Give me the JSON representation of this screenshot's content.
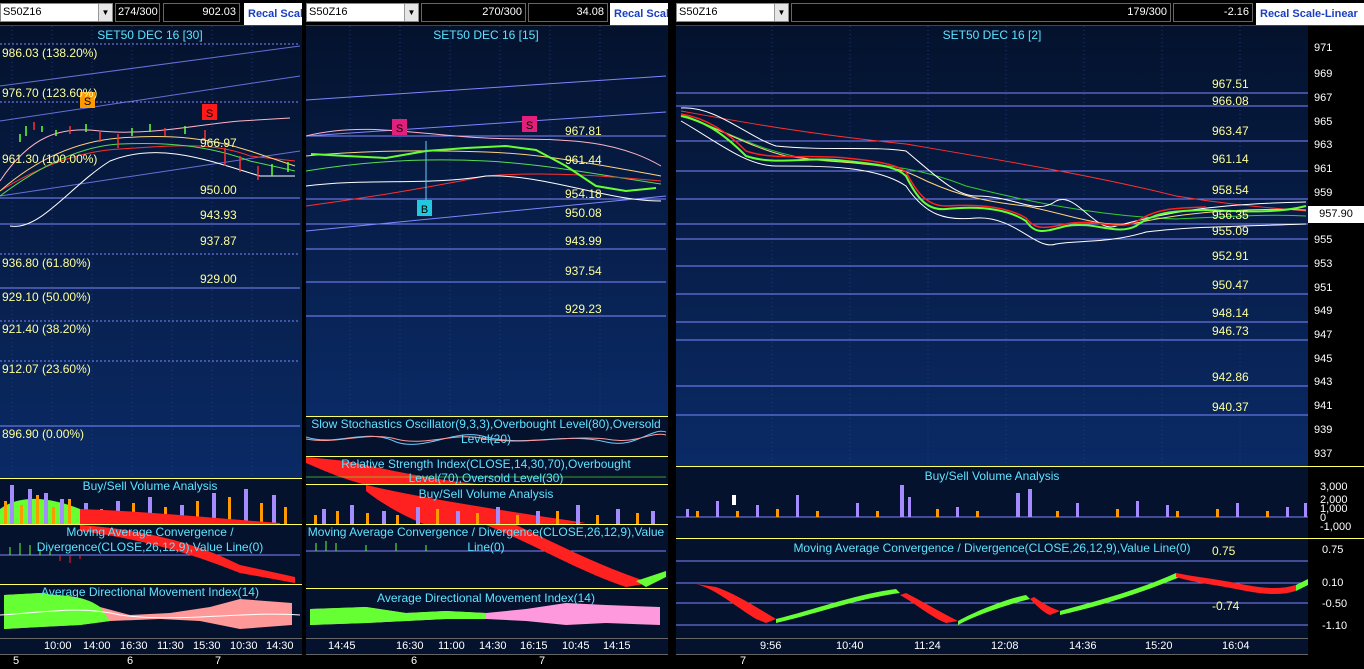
{
  "panes": [
    {
      "symbol": "S50Z16",
      "count": "274/300",
      "last": "902.03",
      "recal": "Recal Scal",
      "title": "SET50 DEC 16  [30]",
      "fib_labels": [
        "986.03 (138.20%)",
        "976.70 (123.60%)",
        "961.30 (100.00%)",
        "936.80 (61.80%)",
        "929.10 (50.00%)",
        "921.40 (38.20%)",
        "912.07 (23.60%)",
        "896.90 (0.00%)"
      ],
      "levels": [
        "966.97",
        "950.00",
        "943.93",
        "937.87",
        "929.00"
      ],
      "indicators": [
        "Buy/Sell Volume Analysis",
        "Moving Average Convergence / Divergence(CLOSE,26,12,9),Value Line(0)",
        "Average Directional Movement Index(14)"
      ],
      "time_labels": [
        "10:00",
        "14:00",
        "16:30",
        "11:30",
        "15:30",
        "10:30",
        "14:30"
      ],
      "day_labels": [
        "5",
        "6",
        "7"
      ]
    },
    {
      "symbol": "S50Z16",
      "count": "270/300",
      "last": "34.08",
      "recal": "Recal Scale",
      "title": "SET50 DEC 16  [15]",
      "levels": [
        "967.81",
        "961.44",
        "954.18",
        "950.08",
        "943.99",
        "937.54",
        "929.23"
      ],
      "indicators": [
        "Slow Stochastics Oscillator(9,3,3),Overbought Level(80),Oversold Level(20)",
        "Relative Strength Index(CLOSE,14,30,70),Overbought Level(70),Oversold Level(30)",
        "Buy/Sell Volume Analysis",
        "Moving Average Convergence / Divergence(CLOSE,26,12,9),Value Line(0)",
        "Average Directional Movement Index(14)"
      ],
      "time_labels": [
        "14:45",
        "16:30",
        "11:00",
        "14:30",
        "16:15",
        "10:45",
        "14:15"
      ],
      "day_labels": [
        "6",
        "7"
      ]
    },
    {
      "symbol": "S50Z16",
      "count": "179/300",
      "last": "-2.16",
      "recal": "Recal Scale-Linear",
      "title": "SET50 DEC 16  [2]",
      "levels": [
        "967.51",
        "966.08",
        "963.47",
        "961.14",
        "958.54",
        "956.35",
        "955.09",
        "952.91",
        "950.47",
        "948.14",
        "946.73",
        "942.86",
        "940.37"
      ],
      "price_axis": [
        "971",
        "969",
        "967",
        "965",
        "963",
        "961",
        "959",
        "957",
        "955",
        "953",
        "951",
        "949",
        "947",
        "945",
        "943",
        "941",
        "939",
        "937"
      ],
      "current_price": "957.90",
      "indicators": [
        "Buy/Sell Volume Analysis",
        "Moving Average Convergence / Divergence(CLOSE,26,12,9),Value Line(0)"
      ],
      "volume_axis": [
        "3,000",
        "2,000",
        "1,000",
        "0",
        "-1,000"
      ],
      "macd_axis": [
        "0.75",
        "0.10",
        "-0.50",
        "-1.10"
      ],
      "macd_values": [
        "0.75",
        "-0.74"
      ],
      "time_labels": [
        "9:56",
        "10:40",
        "11:24",
        "12:08",
        "14:36",
        "15:20",
        "16:04"
      ],
      "day_labels": [
        "7"
      ]
    }
  ],
  "signals": [
    "S",
    "S",
    "S",
    "S",
    "B"
  ],
  "colors": {
    "background": "#0a2a66",
    "level_line": "#7f86ff",
    "level_text": "#ffff99",
    "title_text": "#5fe4ff",
    "bull": "#66ff33",
    "bear": "#ff2020"
  }
}
